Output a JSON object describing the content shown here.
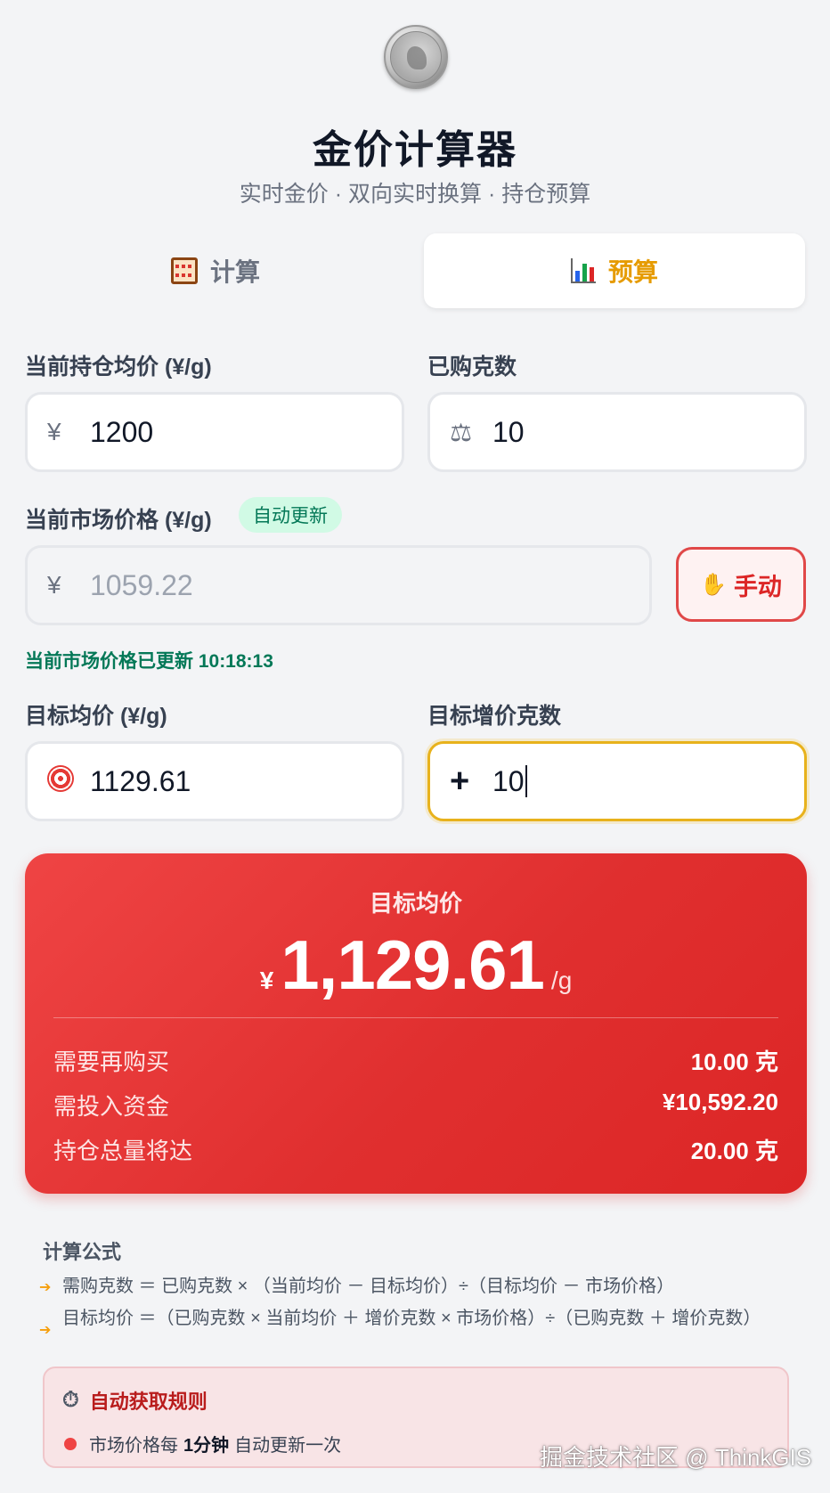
{
  "header": {
    "title": "金价计算器",
    "subtitle": "实时金价 · 双向实时换算 · 持仓预算"
  },
  "tabs": [
    {
      "label": "计算",
      "icon": "abacus-icon",
      "active": false
    },
    {
      "label": "预算",
      "icon": "bar-chart-icon",
      "active": true
    }
  ],
  "form": {
    "avg_price_label": "当前持仓均价 (¥/g)",
    "avg_price_prefix": "¥",
    "avg_price_value": "1200",
    "bought_grams_label": "已购克数",
    "bought_grams_value": "10",
    "market_price_label": "当前市场价格 (¥/g)",
    "auto_update_badge": "自动更新",
    "market_price_prefix": "¥",
    "market_price_value": "1059.22",
    "manual_button": "手动",
    "status_text": "当前市场价格已更新 10:18:13",
    "target_avg_label": "目标均价 (¥/g)",
    "target_avg_value": "1129.61",
    "target_grams_label": "目标增价克数",
    "target_grams_prefix": "+",
    "target_grams_value": "10"
  },
  "result": {
    "title": "目标均价",
    "currency": "¥",
    "value": "1,129.61",
    "unit": "/g",
    "rows": [
      {
        "label": "需要再购买",
        "value": "10.00 克"
      },
      {
        "label": "需投入资金",
        "value": "¥10,592.20"
      },
      {
        "label": "持仓总量将达",
        "value": "20.00 克"
      }
    ]
  },
  "formulas": {
    "title": "计算公式",
    "items": [
      "需购克数 ＝ 已购克数 × （当前均价 － 目标均价）÷（目标均价 － 市场价格）",
      "目标均价 ＝（已购克数 × 当前均价 ＋ 增价克数 × 市场价格）÷（已购克数 ＋ 增价克数）"
    ]
  },
  "rules": {
    "title": "自动获取规则",
    "item_prefix": "市场价格每",
    "item_bold": "1分钟",
    "item_suffix": "自动更新一次"
  },
  "watermark": "掘金技术社区 @ ThinkGIS",
  "colors": {
    "accent": "#e69b00",
    "result_bg": "#e53e3e",
    "success": "#047857",
    "danger": "#dc2626"
  }
}
